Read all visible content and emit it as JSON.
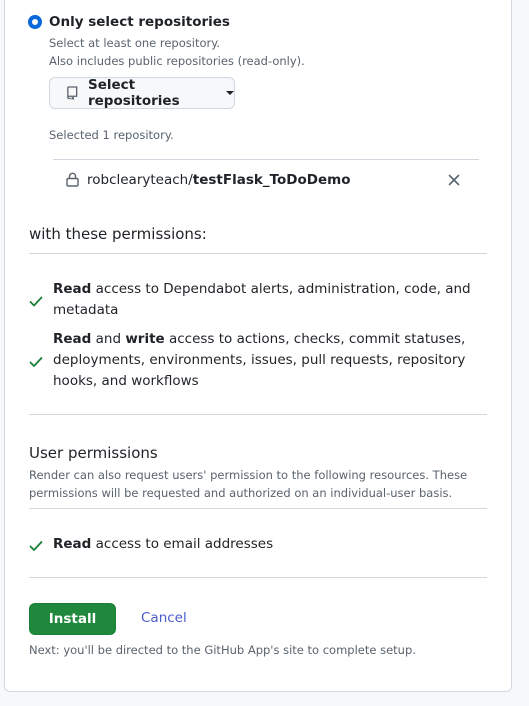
{
  "repo_access": {
    "option_label": "Only select repositories",
    "hint_line1": "Select at least one repository.",
    "hint_line2": "Also includes public repositories (read-only).",
    "select_button_label": "Select repositories",
    "selected_count": "Selected 1 repository.",
    "selected_repo": {
      "owner": "robclearyteach/",
      "name": "testFlask_ToDoDemo"
    }
  },
  "permissions": {
    "heading": "with these permissions:",
    "items": [
      {
        "strong": "Read",
        "rest": " access to Dependabot alerts, administration, code, and metadata"
      },
      {
        "strong": "Read",
        "mid": " and ",
        "strong2": "write",
        "rest": " access to actions, checks, commit statuses, deployments, environments, issues, pull requests, repository hooks, and workflows"
      }
    ]
  },
  "user_permissions": {
    "heading": "User permissions",
    "description": "Render can also request users' permission to the following resources. These permissions will be requested and authorized on an individual-user basis.",
    "items": [
      {
        "strong": "Read",
        "rest": " access to email addresses"
      }
    ]
  },
  "actions": {
    "install_label": "Install",
    "cancel_label": "Cancel",
    "next_note": "Next: you'll be directed to the GitHub App's site to complete setup."
  },
  "colors": {
    "accent": "#0969da",
    "install_green": "#1f883d",
    "check_green": "#1a7f37",
    "link": "#4a5bcc"
  }
}
